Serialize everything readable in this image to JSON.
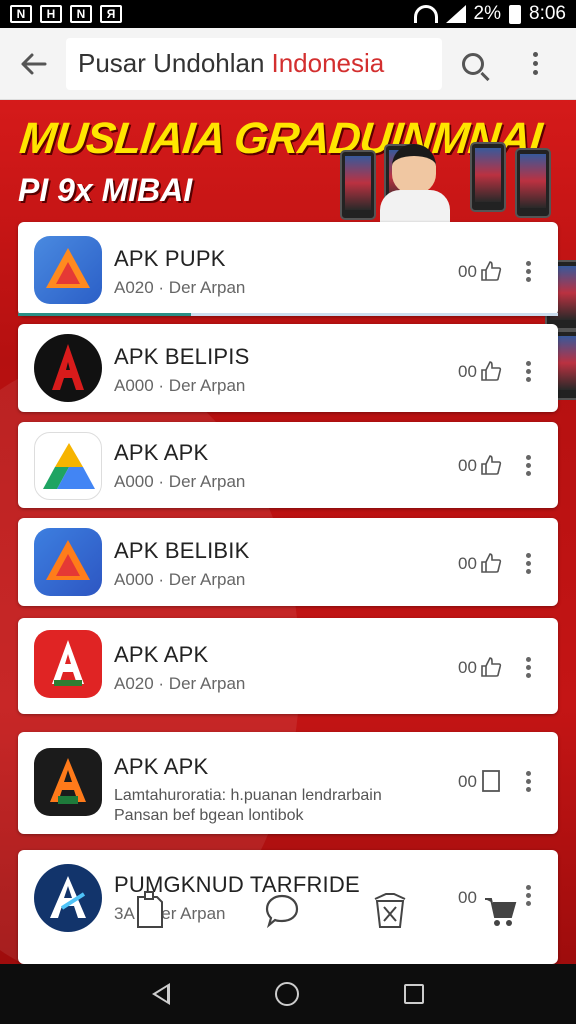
{
  "status_bar": {
    "left_icons": [
      "notification-icon",
      "notification-icon",
      "notification-icon",
      "notification-icon"
    ],
    "left_glyphs": [
      "N",
      "H",
      "N",
      "Я"
    ],
    "battery": "2%",
    "time": "8:06"
  },
  "app_bar": {
    "title_main": "Pusar Undohlan",
    "title_accent": "Indonesia",
    "accent_color": "#d32f2f"
  },
  "banner": {
    "headline": "MUSLIAIA GRADUINMNAI",
    "subline": "PI 9x MIBAI"
  },
  "apps": [
    {
      "name": "APK PUPK",
      "meta": "A020 · Der Arpan",
      "count": "00",
      "icon": "play-triangle-icon",
      "progress": 0.32
    },
    {
      "name": "APK BELIPIS",
      "meta": "A000 · Der Arpan",
      "count": "00",
      "icon": "letter-a-icon"
    },
    {
      "name": "APK APK",
      "meta": "A000 · Der Arpan",
      "count": "00",
      "icon": "drive-triangle-icon"
    },
    {
      "name": "APK BELIBIK",
      "meta": "A000 · Der Arpan",
      "count": "00",
      "icon": "play-triangle-icon"
    },
    {
      "name": "APK APK",
      "meta": "A020 · Der Arpan",
      "count": "00",
      "icon": "letter-a-icon"
    },
    {
      "name": "APK APK",
      "desc_line1": "Lamtahuroratia: h.puanan lendrarbain",
      "desc_line2": "Pansan bef bgean lontibok",
      "count": "00",
      "icon": "letter-a-icon"
    },
    {
      "name": "PUMGKNUD TARFRIDE",
      "meta": "3A · Der Arpan",
      "count": "00",
      "icon": "letter-a-icon"
    }
  ],
  "colors": {
    "banner_red": "#c41515",
    "headline_yellow": "#ffe500",
    "progress_teal": "#2a8f86"
  }
}
